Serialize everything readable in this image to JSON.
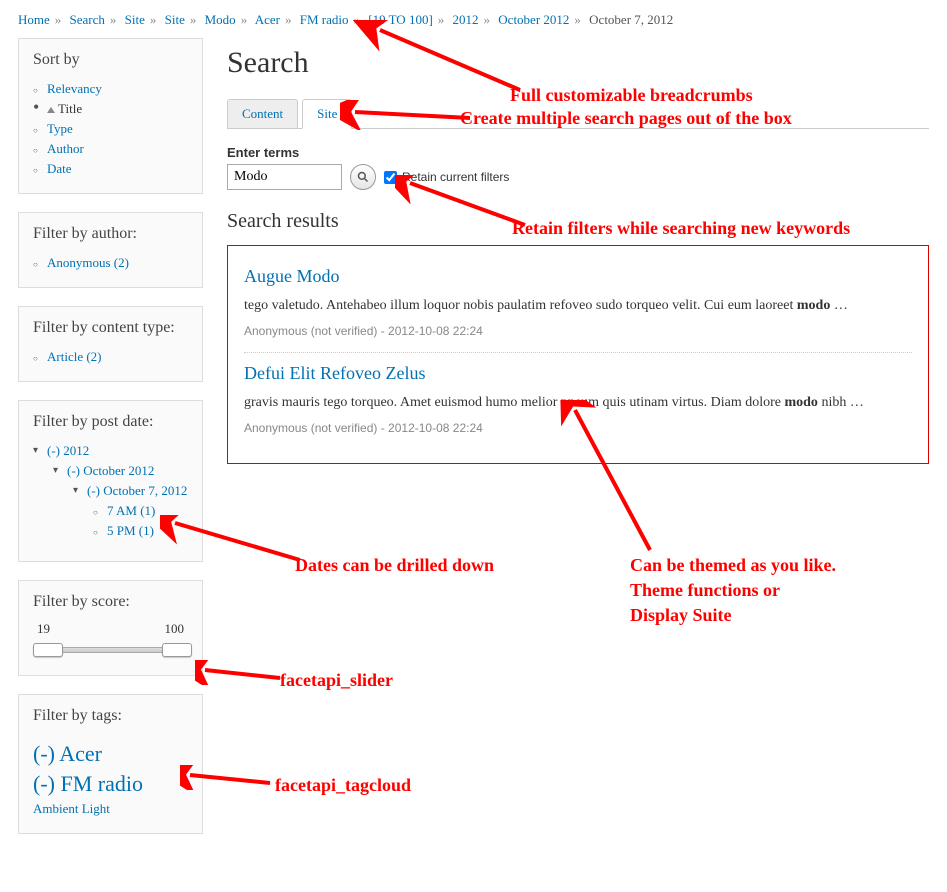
{
  "breadcrumb": [
    {
      "label": "Home",
      "link": true
    },
    {
      "label": "Search",
      "link": true
    },
    {
      "label": "Site",
      "link": true
    },
    {
      "label": "Site",
      "link": true
    },
    {
      "label": "Modo",
      "link": true
    },
    {
      "label": "Acer",
      "link": true
    },
    {
      "label": "FM radio",
      "link": true
    },
    {
      "label": "[19 TO 100]",
      "link": true
    },
    {
      "label": "2012",
      "link": true
    },
    {
      "label": "October 2012",
      "link": true
    },
    {
      "label": "October 7, 2012",
      "link": false
    }
  ],
  "sidebar": {
    "sort": {
      "title": "Sort by",
      "items": [
        "Relevancy",
        "Title",
        "Type",
        "Author",
        "Date"
      ],
      "active": "Title"
    },
    "author": {
      "title": "Filter by author:",
      "items": [
        "Anonymous (2)"
      ]
    },
    "content_type": {
      "title": "Filter by content type:",
      "items": [
        "Article (2)"
      ]
    },
    "post_date": {
      "title": "Filter by post date:",
      "tree": {
        "l0": "(-) 2012",
        "l1": "(-) October 2012",
        "l2": "(-) October 7, 2012",
        "leaves": [
          "7 AM (1)",
          "5 PM (1)"
        ]
      }
    },
    "score": {
      "title": "Filter by score:",
      "min": "19",
      "max": "100"
    },
    "tags": {
      "title": "Filter by tags:",
      "big": [
        "(-) Acer",
        "(-) FM radio"
      ],
      "small": [
        "Ambient Light"
      ]
    }
  },
  "main": {
    "title": "Search",
    "tabs": [
      {
        "label": "Content",
        "active": false
      },
      {
        "label": "Site",
        "active": true
      }
    ],
    "form": {
      "label": "Enter terms",
      "value": "Modo",
      "checkbox": "Retain current filters",
      "checked": true
    },
    "results_title": "Search results",
    "results": [
      {
        "title": "Augue Modo",
        "snippet_pre": "tego valetudo. Antehabeo illum loquor nobis paulatim refoveo sudo torqueo velit. Cui eum laoreet ",
        "snippet_bold": "modo",
        "snippet_post": " …",
        "meta": "Anonymous (not verified) - 2012-10-08 22:24"
      },
      {
        "title": "Defui Elit Refoveo Zelus",
        "snippet_pre": "gravis mauris tego torqueo. Amet euismod humo melior pneum quis utinam virtus. Diam dolore ",
        "snippet_bold": "modo",
        "snippet_post": " nibh …",
        "meta": "Anonymous (not verified) - 2012-10-08 22:24"
      }
    ]
  },
  "annotations": {
    "a1": "Full customizable breadcrumbs",
    "a2": "Create multiple search pages out of the box",
    "a3": "Retain filters while searching new keywords",
    "a4": "Dates can be drilled down",
    "a5": "Can be themed as you like.",
    "a5b": "Theme functions or",
    "a5c": "Display Suite",
    "a6": "facetapi_slider",
    "a7": "facetapi_tagcloud"
  }
}
